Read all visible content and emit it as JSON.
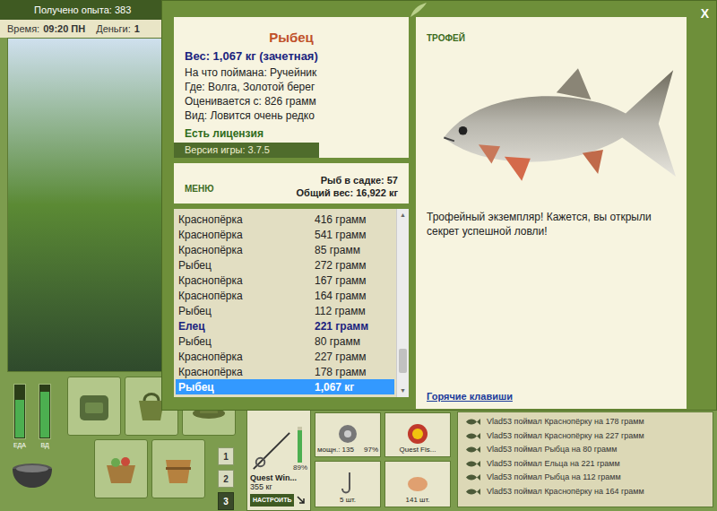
{
  "hud": {
    "experience": "Получено опыта: 383",
    "time_label": "Время:",
    "time": "09:20 ПН",
    "money_label": "Деньги:",
    "money": "1"
  },
  "dialog": {
    "close": "X",
    "fish_name": "Рыбец",
    "weight": "Вес: 1,067 кг (зачетная)",
    "details": [
      "На что поймана: Ручейник",
      "Где: Волга, Золотой берег",
      "Оценивается с: 826 грамм",
      "Вид: Ловится очень редко"
    ],
    "license": "Есть лицензия",
    "version": "Версия игры: 3.7.5",
    "menu": "МЕНЮ",
    "keepnet_count": "Рыб в садке: 57",
    "total_weight": "Общий вес: 16,922 кг",
    "catch_list": [
      {
        "name": "Краснопёрка",
        "weight": "416 грамм",
        "highlighted": false,
        "selected": false
      },
      {
        "name": "Краснопёрка",
        "weight": "541 грамм",
        "highlighted": false,
        "selected": false
      },
      {
        "name": "Краснопёрка",
        "weight": "85 грамм",
        "highlighted": false,
        "selected": false
      },
      {
        "name": "Рыбец",
        "weight": "272 грамм",
        "highlighted": false,
        "selected": false
      },
      {
        "name": "Краснопёрка",
        "weight": "167 грамм",
        "highlighted": false,
        "selected": false
      },
      {
        "name": "Краснопёрка",
        "weight": "164 грамм",
        "highlighted": false,
        "selected": false
      },
      {
        "name": "Рыбец",
        "weight": "112 грамм",
        "highlighted": false,
        "selected": false
      },
      {
        "name": "Елец",
        "weight": "221 грамм",
        "highlighted": true,
        "selected": false
      },
      {
        "name": "Рыбец",
        "weight": "80 грамм",
        "highlighted": false,
        "selected": false
      },
      {
        "name": "Краснопёрка",
        "weight": "227 грамм",
        "highlighted": false,
        "selected": false
      },
      {
        "name": "Краснопёрка",
        "weight": "178 грамм",
        "highlighted": false,
        "selected": false
      },
      {
        "name": "Рыбец",
        "weight": "1,067 кг",
        "highlighted": false,
        "selected": true
      }
    ],
    "scrollbar": {
      "thumb_start": 0.78,
      "thumb_size": 0.15
    },
    "trophy": {
      "label": "ТРОФЕЙ",
      "message": "Трофейный экземпляр! Кажется, вы открыли секрет успешной ловли!",
      "hotkeys": "Горячие клавиши"
    }
  },
  "gauges": [
    {
      "label": "ЕДА",
      "level": 0.72
    },
    {
      "label": "ВД",
      "level": 0.88
    }
  ],
  "tool_buttons": [
    {
      "label": "1",
      "selected": false
    },
    {
      "label": "2",
      "selected": false
    },
    {
      "label": "3",
      "selected": true
    }
  ],
  "tackle": {
    "rod_durability": "89%",
    "rod_level": 0.89,
    "rod_name": "Quest Win...",
    "rod_load": "355 кг",
    "setup": "НАСТРОИТЬ",
    "reel_power": "мощн.: 135",
    "reel_durability": "97%",
    "line_name": "Quest Fis...",
    "hooks": "5 шт.",
    "bait": "141 шт."
  },
  "chat": [
    "Vlad53 поймал Краснопёрку на 178 грамм",
    "Vlad53 поймал Краснопёрку на 227 грамм",
    "Vlad53 поймал Рыбца на 80 грамм",
    "Vlad53 поймал Ельца на 221 грамм",
    "Vlad53 поймал Рыбца на 112 грамм",
    "Vlad53 поймал Краснопёрку на 164 грамм"
  ]
}
